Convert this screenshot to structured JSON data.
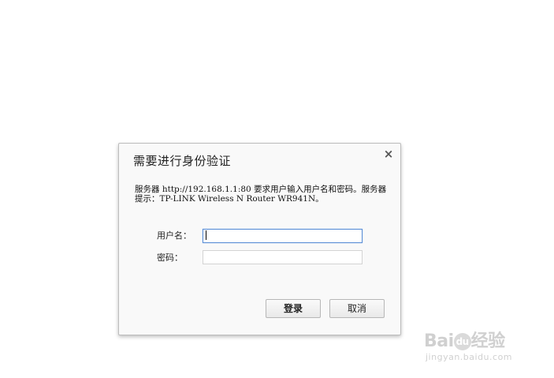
{
  "dialog": {
    "title": "需要进行身份验证",
    "close_symbol": "×",
    "message": "服务器 http://192.168.1.1:80 要求用户输入用户名和密码。服务器提示：TP-LINK Wireless N Router WR941N。",
    "username_label": "用户名：",
    "username_value": "",
    "password_label": "密码：",
    "password_value": "",
    "login_button": "登录",
    "cancel_button": "取消"
  },
  "watermark": {
    "logo_text": "Baidu经验",
    "logo_left": "Bai",
    "logo_paw": "du",
    "logo_right": "经验",
    "url": "jingyan.baidu.com"
  },
  "colors": {
    "focus_border": "#5c8fd6",
    "dialog_bg": "#f9f9f9"
  }
}
